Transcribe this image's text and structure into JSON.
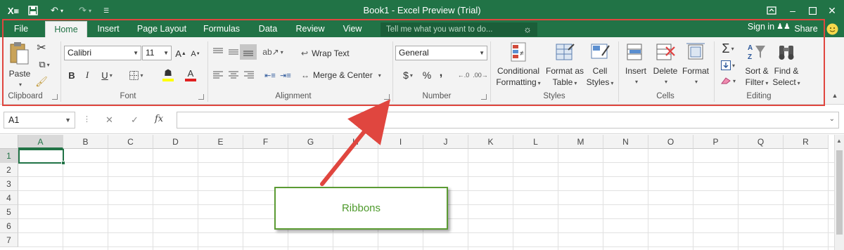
{
  "titlebar": {
    "title": "Book1 - Excel Preview (Trial)",
    "app_icon": "X",
    "save_icon": "save-icon",
    "undo_icon": "undo-icon",
    "redo_icon": "redo-icon",
    "customize_icon": "customize-qat-icon",
    "ribbon_display_icon": "ribbon-display-options-icon",
    "minimize": "minimize-icon",
    "maximize": "maximize-icon",
    "close": "close-icon"
  },
  "tabs": [
    {
      "label": "File"
    },
    {
      "label": "Home"
    },
    {
      "label": "Insert"
    },
    {
      "label": "Page Layout"
    },
    {
      "label": "Formulas"
    },
    {
      "label": "Data"
    },
    {
      "label": "Review"
    },
    {
      "label": "View"
    }
  ],
  "tellme": {
    "placeholder": "Tell me what you want to do..."
  },
  "account": {
    "signin": "Sign in",
    "share": "Share"
  },
  "ribbon": {
    "clipboard": {
      "label": "Clipboard",
      "paste": "Paste"
    },
    "font": {
      "label": "Font",
      "name": "Calibri",
      "size": "11",
      "bold": "B",
      "italic": "I",
      "underline": "U",
      "font_color": "A"
    },
    "alignment": {
      "label": "Alignment",
      "wrap": "Wrap Text",
      "merge": "Merge & Center"
    },
    "number": {
      "label": "Number",
      "format": "General",
      "currency": "$",
      "percent": "%",
      "comma": ","
    },
    "styles": {
      "label": "Styles",
      "conditional": [
        "Conditional",
        "Formatting"
      ],
      "format_table": [
        "Format as",
        "Table"
      ],
      "cell_styles": [
        "Cell",
        "Styles"
      ]
    },
    "cells": {
      "label": "Cells",
      "insert": "Insert",
      "delete": "Delete",
      "format": "Format"
    },
    "editing": {
      "label": "Editing",
      "sort": [
        "Sort &",
        "Filter"
      ],
      "find": [
        "Find &",
        "Select"
      ]
    }
  },
  "formulabar": {
    "namebox": "A1",
    "fx": "fx",
    "value": ""
  },
  "grid": {
    "columns": [
      "A",
      "B",
      "C",
      "D",
      "E",
      "F",
      "G",
      "H",
      "I",
      "J",
      "K",
      "L",
      "M",
      "N",
      "O",
      "P",
      "Q",
      "R"
    ],
    "rows": [
      "1",
      "2",
      "3",
      "4",
      "5",
      "6",
      "7"
    ],
    "selected_cell": "A1"
  },
  "callout": {
    "text": "Ribbons"
  },
  "colors": {
    "brand": "#217346",
    "highlight": "#e0463f",
    "callout": "#5b9b33"
  }
}
